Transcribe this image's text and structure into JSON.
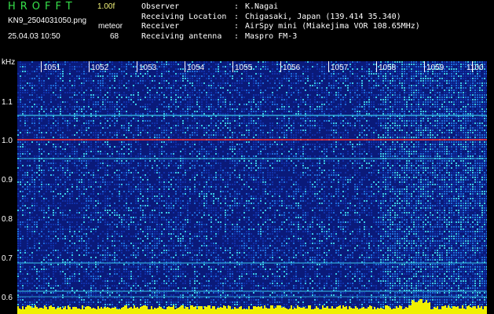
{
  "header": {
    "title": "HROFFT",
    "version": "1.00f",
    "filename": "KN9_2504031050.png",
    "timestamp": "25.04.03 10:50",
    "meteor_label": "meteor",
    "meteor_count": "68"
  },
  "station": [
    {
      "key": "Observer",
      "value": "K.Nagai"
    },
    {
      "key": "Receiving Location",
      "value": "Chigasaki, Japan (139.414 35.340)"
    },
    {
      "key": "Receiver",
      "value": "AirSpy mini (Miakejima VOR 108.65MHz)"
    },
    {
      "key": "Receiving antenna",
      "value": "Maspro FM-3"
    }
  ],
  "colon": ":",
  "axis": {
    "y_unit": "kHz",
    "y_ticks": [
      "1.1",
      "1.0",
      "0.9",
      "0.8",
      "0.7",
      "0.6"
    ],
    "x_ticks": [
      "1051",
      "1052",
      "1053",
      "1054",
      "1055",
      "1056",
      "1057",
      "1058",
      "1059",
      "1100"
    ]
  },
  "colors": {
    "background": "#0a1a7a",
    "noise_dark": "#1030a8",
    "noise_mid": "#1d6ad8",
    "noise_bright": "#3ac8e8",
    "carrier": "#ff3030",
    "baseline": "#f0f000"
  }
}
